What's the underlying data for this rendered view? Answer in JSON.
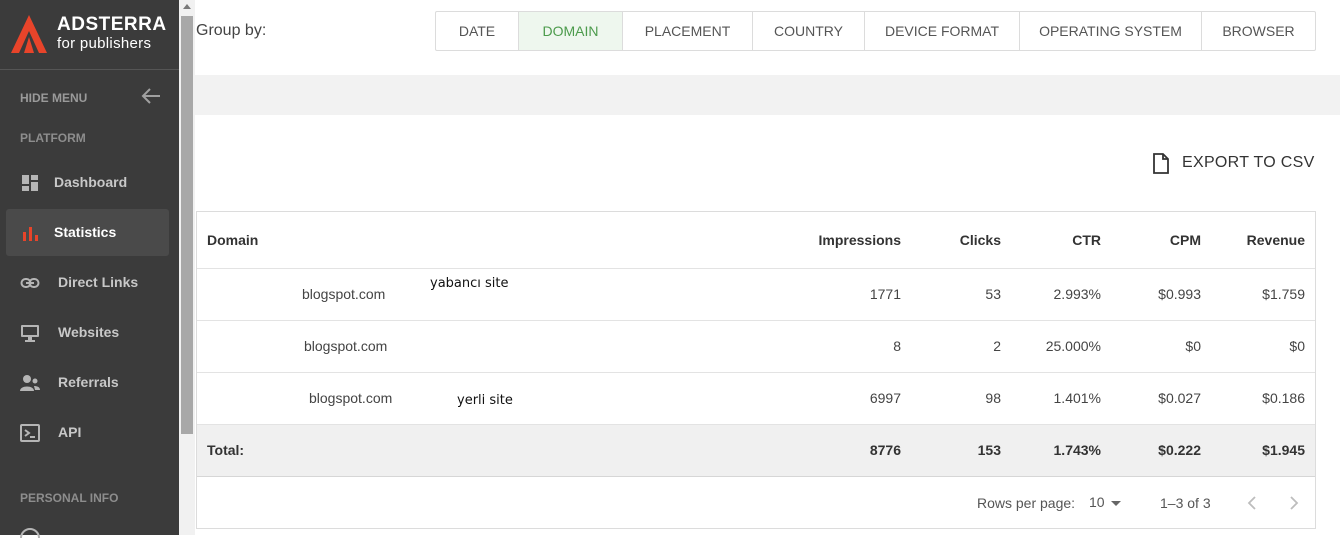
{
  "brand": {
    "name": "ADSTERRA",
    "tagline": "for publishers",
    "accent": "#e8442a"
  },
  "sidebar": {
    "hide_menu": "HIDE MENU",
    "platform_label": "PLATFORM",
    "items": [
      {
        "label": "Dashboard",
        "icon": "dashboard-icon"
      },
      {
        "label": "Statistics",
        "icon": "bar-chart-icon",
        "active": true
      },
      {
        "label": "Direct Links",
        "icon": "link-icon"
      },
      {
        "label": "Websites",
        "icon": "monitor-icon"
      },
      {
        "label": "Referrals",
        "icon": "people-icon"
      },
      {
        "label": "API",
        "icon": "terminal-icon"
      }
    ],
    "personal_label": "PERSONAL INFO"
  },
  "groupby": {
    "label": "Group by:",
    "tabs": [
      "DATE",
      "DOMAIN",
      "PLACEMENT",
      "COUNTRY",
      "DEVICE FORMAT",
      "OPERATING SYSTEM",
      "BROWSER"
    ],
    "active": "DOMAIN"
  },
  "export": {
    "label": "EXPORT TO CSV"
  },
  "table": {
    "headers": {
      "domain": "Domain",
      "impressions": "Impressions",
      "clicks": "Clicks",
      "ctr": "CTR",
      "cpm": "CPM",
      "revenue": "Revenue"
    },
    "rows": [
      {
        "domain": "blogspot.com",
        "note": "yabancı site",
        "impressions": "1771",
        "clicks": "53",
        "ctr": "2.993%",
        "cpm": "$0.993",
        "revenue": "$1.759"
      },
      {
        "domain": "blogspot.com",
        "note": "",
        "impressions": "8",
        "clicks": "2",
        "ctr": "25.000%",
        "cpm": "$0",
        "revenue": "$0"
      },
      {
        "domain": "blogspot.com",
        "note": "yerli site",
        "impressions": "6997",
        "clicks": "98",
        "ctr": "1.401%",
        "cpm": "$0.027",
        "revenue": "$0.186"
      }
    ],
    "total": {
      "label": "Total:",
      "impressions": "8776",
      "clicks": "153",
      "ctr": "1.743%",
      "cpm": "$0.222",
      "revenue": "$1.945"
    }
  },
  "pagination": {
    "rows_per_page_label": "Rows per page:",
    "rows_per_page": "10",
    "range": "1–3 of 3"
  }
}
